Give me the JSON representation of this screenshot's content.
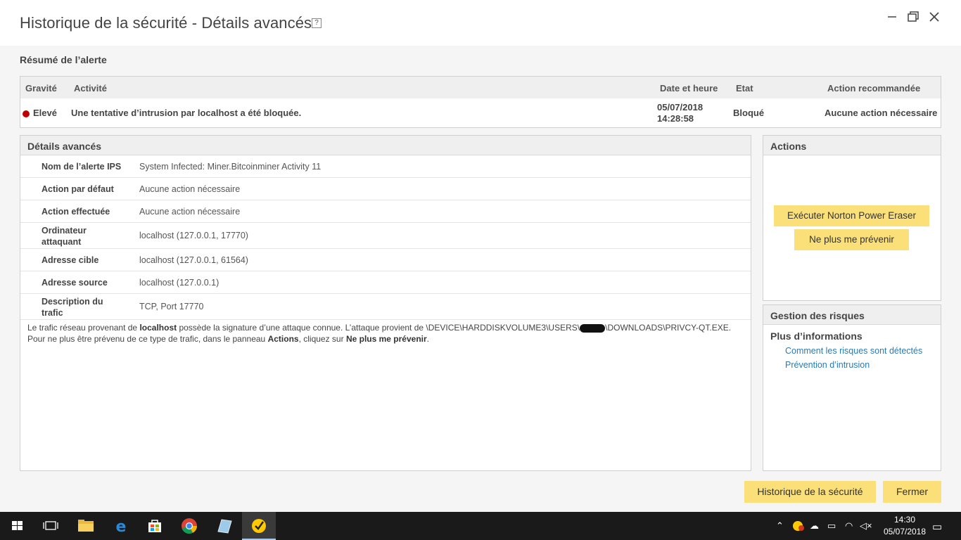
{
  "window": {
    "title": "Historique de la sécurité - Détails avancés",
    "help_label": "?",
    "minimize_label": "—",
    "maximize_label": "❐",
    "close_label": "✕"
  },
  "alert_summary": {
    "title": "Résumé de l’alerte",
    "columns": [
      "Gravité",
      "Activité",
      "Date et heure",
      "Etat",
      "Action recommandée"
    ],
    "row": {
      "severity": "Elevé",
      "severity_color": "#c00000",
      "activity": "Une tentative d’intrusion par localhost a été bloquée.",
      "date": "05/07/2018",
      "time": "14:28:58",
      "state": "Bloqué",
      "recommended_action": "Aucune action nécessaire"
    }
  },
  "details": {
    "title": "Détails avancés",
    "rows": [
      {
        "label": "Nom de l’alerte IPS",
        "value": "System Infected: Miner.Bitcoinminer Activity 11"
      },
      {
        "label": "Action par défaut",
        "value": "Aucune action nécessaire"
      },
      {
        "label": "Action effectuée",
        "value": "Aucune action nécessaire"
      },
      {
        "label": "Ordinateur attaquant",
        "value": "localhost (127.0.0.1, 17770)"
      },
      {
        "label": "Adresse cible",
        "value": "localhost (127.0.0.1, 61564)"
      },
      {
        "label": "Adresse source",
        "value": "localhost (127.0.0.1)"
      },
      {
        "label": "Description du trafic",
        "value": "TCP, Port 17770"
      }
    ],
    "description": {
      "p1": "Le trafic réseau provenant de ",
      "b1": "localhost",
      "p2": " possède la signature d’une attaque connue. L’attaque provient de \\DEVICE\\HARDDISKVOLUME3\\USERS\\",
      "p3": "\\DOWNLOADS\\PRIVCY-QT.EXE. Pour ne plus être prévenu de ce type de trafic, dans le panneau ",
      "b2": "Actions",
      "p4": ", cliquez sur ",
      "b3": "Ne plus me prévenir",
      "p5": "."
    }
  },
  "actions": {
    "title": "Actions",
    "run_npe_label": "Exécuter Norton Power Eraser",
    "dont_warn_label": "Ne plus me prévenir"
  },
  "risk": {
    "title": "Gestion des risques",
    "subtitle": "Plus d’informations",
    "links": [
      "Comment les risques sont détectés",
      "Prévention d’intrusion"
    ]
  },
  "footer": {
    "history_label": "Historique de la sécurité",
    "close_label": "Fermer"
  },
  "taskbar": {
    "time": "14:30",
    "date": "05/07/2018",
    "colors": {
      "bg": "#1a1a1a",
      "accent": "#fbe07a",
      "link": "#2a7ab5"
    }
  }
}
